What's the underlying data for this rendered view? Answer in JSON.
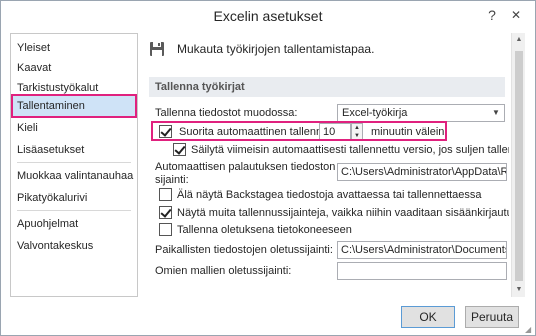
{
  "window": {
    "title": "Excelin asetukset",
    "help_glyph": "?",
    "close_glyph": "✕"
  },
  "nav": {
    "items": [
      {
        "label": "Yleiset"
      },
      {
        "label": "Kaavat"
      },
      {
        "label": "Tarkistustyökalut"
      },
      {
        "label": "Tallentaminen"
      },
      {
        "label": "Kieli"
      },
      {
        "label": "Lisäasetukset"
      },
      {
        "label": "Muokkaa valintanauhaa"
      },
      {
        "label": "Pikatyökalurivi"
      },
      {
        "label": "Apuohjelmat"
      },
      {
        "label": "Valvontakeskus"
      }
    ],
    "selected": "Tallentaminen"
  },
  "content": {
    "header_text": "Mukauta työkirjojen tallentamistapaa.",
    "header_icon": "floppy-disk-icon",
    "section_title": "Tallenna työkirjat",
    "save_format_label": "Tallenna tiedostot muodossa:",
    "save_format_value": "Excel-työkirja",
    "autosave_label": "Suorita automaattinen tallennus",
    "autosave_minutes": "10",
    "autosave_suffix": "minuutin välein",
    "autosave_checked": true,
    "keep_last_label": "Säilytä viimeisin automaattisesti tallennettu versio, jos suljen tallentamatta",
    "keep_last_checked": true,
    "autorecover_label_line1": "Automaattisen palautuksen tiedoston",
    "autorecover_label_line2": "sijainti:",
    "autorecover_value": "C:\\Users\\Administrator\\AppData\\Roami",
    "backstage_label": "Älä näytä Backstagea tiedostoja avattaessa tai tallennettaessa",
    "backstage_checked": false,
    "show_other_label": "Näytä muita tallennussijainteja, vaikka niihin vaaditaan sisäänkirjautuminen.",
    "show_other_checked": true,
    "save_computer_label": "Tallenna oletuksena tietokoneeseen",
    "save_computer_checked": false,
    "local_default_label": "Paikallisten tiedostojen oletussijainti:",
    "local_default_value": "C:\\Users\\Administrator\\Documents",
    "templates_label": "Omien mallien oletussijainti:",
    "templates_value": ""
  },
  "buttons": {
    "ok": "OK",
    "cancel": "Peruuta"
  },
  "colors": {
    "highlight": "#e0217e",
    "selected_nav": "#cfe3f7",
    "section_bg": "#e9ecf0"
  }
}
